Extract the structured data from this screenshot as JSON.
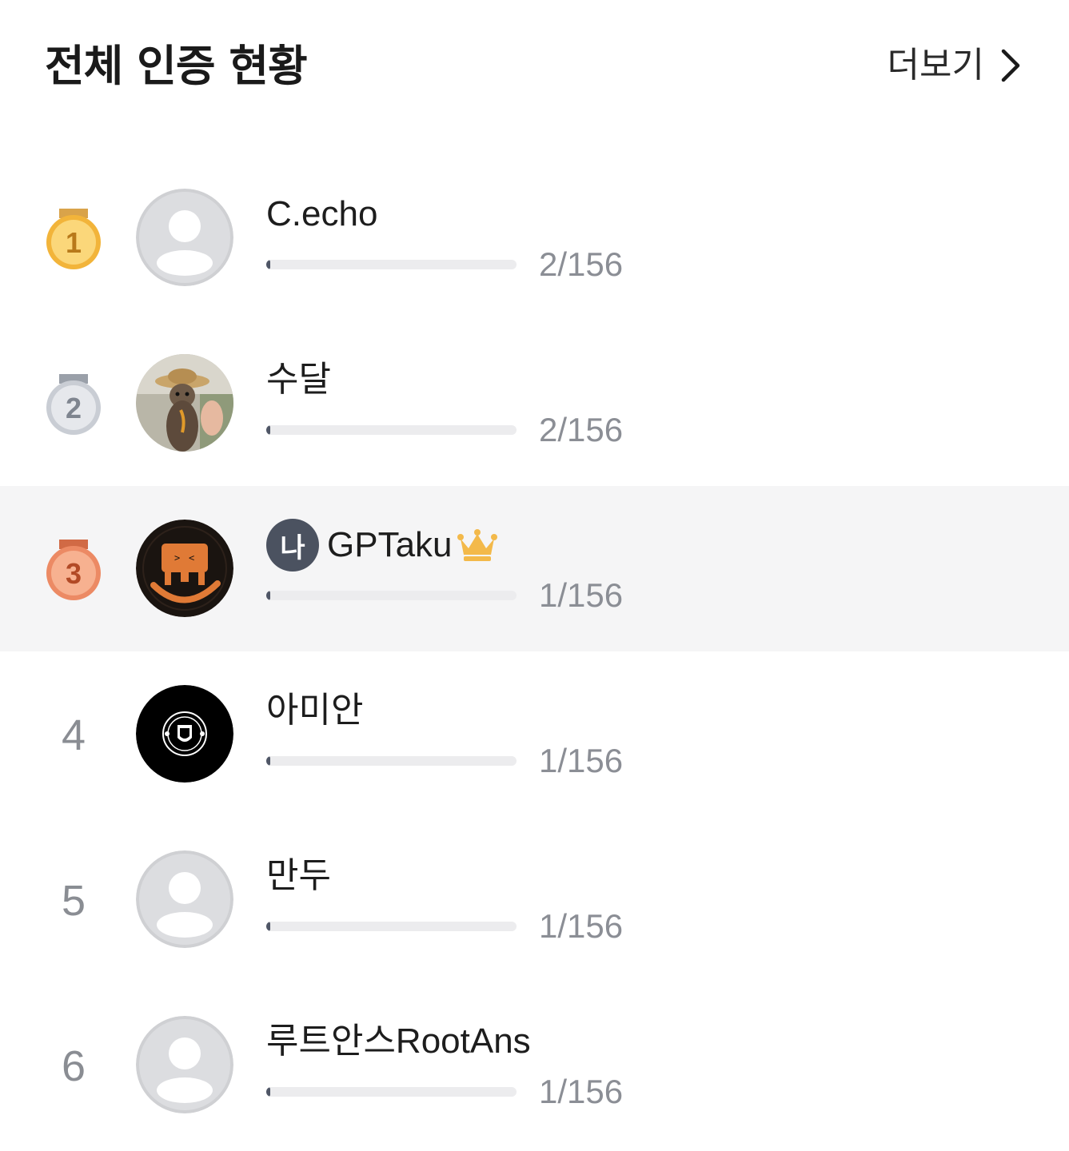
{
  "header": {
    "title": "전체 인증 현황",
    "more_label": "더보기"
  },
  "colors": {
    "gold": "#f2b43a",
    "silver": "#c9cdd4",
    "bronze": "#ec8a64",
    "progress_fill": "#4f5666",
    "progress_track": "#ececee",
    "me_row_bg": "#f5f5f6"
  },
  "rankings": [
    {
      "rank": "1",
      "medal": "gold-medal-icon",
      "avatar": "default-avatar-icon",
      "name": "C.echo",
      "count": "2/156",
      "progress": 0.0128,
      "is_me": false
    },
    {
      "rank": "2",
      "medal": "silver-medal-icon",
      "avatar": "otter-photo",
      "name": "수달",
      "count": "2/156",
      "progress": 0.0128,
      "is_me": false
    },
    {
      "rank": "3",
      "medal": "bronze-medal-icon",
      "avatar": "gptaku-logo",
      "name": "GPTaku",
      "me_label": "나",
      "crown": "crown-icon",
      "count": "1/156",
      "progress": 0.0064,
      "is_me": true
    },
    {
      "rank": "4",
      "avatar": "manchester-united-logo",
      "name": "아미안",
      "count": "1/156",
      "progress": 0.0064,
      "is_me": false
    },
    {
      "rank": "5",
      "avatar": "default-avatar-icon",
      "name": "만두",
      "count": "1/156",
      "progress": 0.0064,
      "is_me": false
    },
    {
      "rank": "6",
      "avatar": "default-avatar-icon",
      "name": "루트안스RootAns",
      "count": "1/156",
      "progress": 0.0064,
      "is_me": false
    }
  ]
}
